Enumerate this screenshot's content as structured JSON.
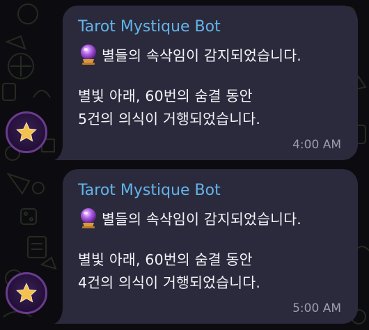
{
  "messages": [
    {
      "sender": "Tarot Mystique Bot",
      "icon": "crystal-ball-icon",
      "line1": "별들의 속삭임이 감지되었습니다.",
      "line2": "별빛 아래, 60번의 숨결 동안",
      "line3": "5건의 의식이 거행되었습니다.",
      "time": "4:00 AM"
    },
    {
      "sender": "Tarot Mystique Bot",
      "icon": "crystal-ball-icon",
      "line1": "별들의 속삭임이 감지되었습니다.",
      "line2": "별빛 아래, 60번의 숨결 동안",
      "line3": "4건의 의식이 거행되었습니다.",
      "time": "5:00 AM"
    }
  ],
  "colors": {
    "bubble": "#2b2a3d",
    "sender": "#62b4e8",
    "text": "#f3f3f7",
    "time": "#9a9cb0",
    "avatar_ring": "#6a3b8f",
    "star": "#f2c14e"
  }
}
